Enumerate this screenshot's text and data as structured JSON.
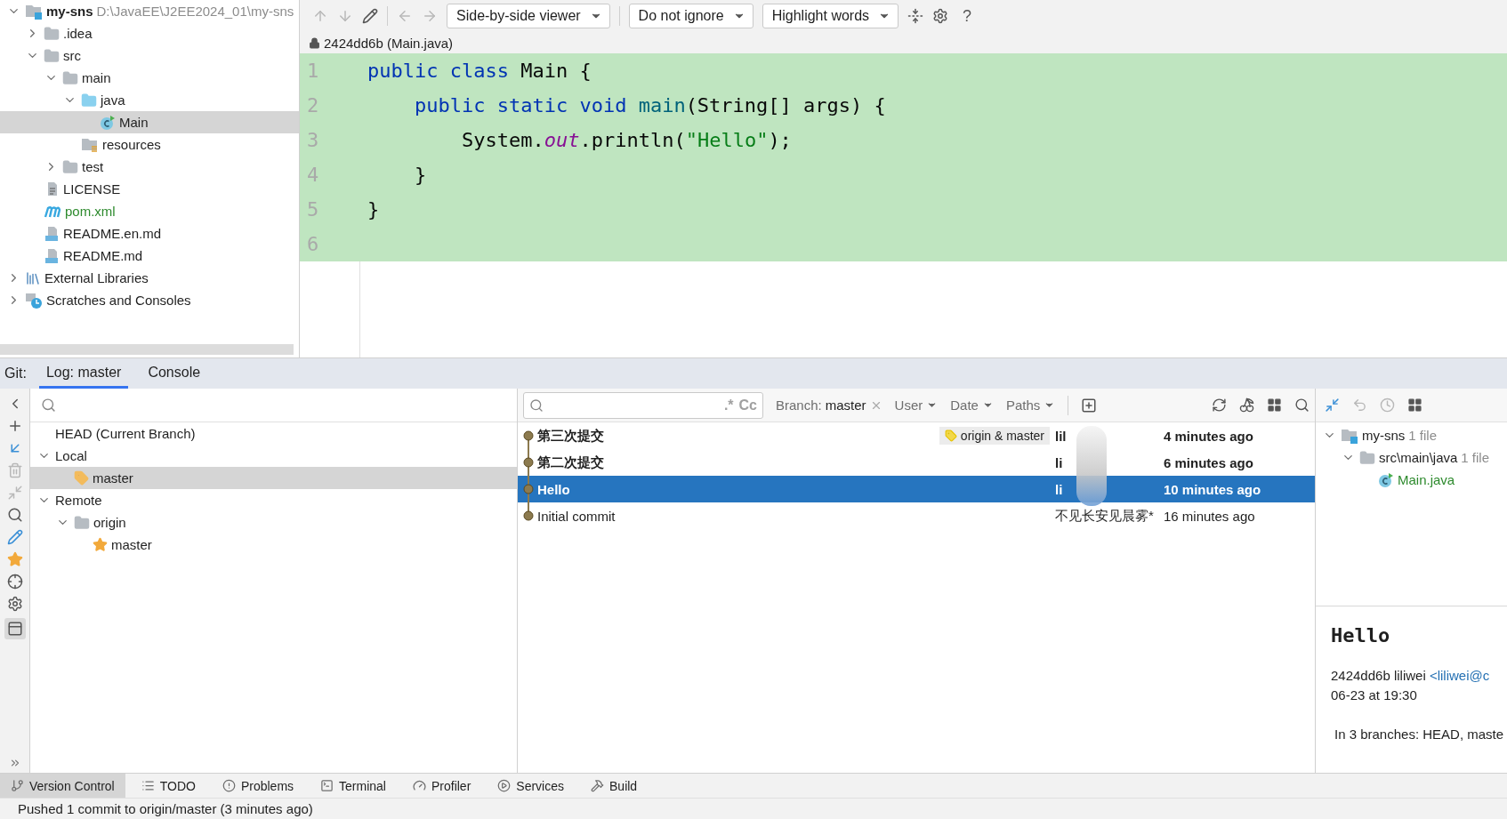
{
  "project": {
    "tree": [
      {
        "label": "my-sns",
        "detail": "D:\\JavaEE\\J2EE2024_01\\my-sns",
        "kind": "module",
        "expanded": true,
        "selected": false,
        "added": false,
        "children": [
          {
            "label": ".idea",
            "kind": "folder",
            "expanded": false,
            "selected": false,
            "added": false
          },
          {
            "label": "src",
            "kind": "folder",
            "expanded": true,
            "selected": false,
            "added": false,
            "children": [
              {
                "label": "main",
                "kind": "folder",
                "expanded": true,
                "selected": false,
                "added": false,
                "children": [
                  {
                    "label": "java",
                    "kind": "source-folder",
                    "expanded": true,
                    "selected": false,
                    "added": false,
                    "children": [
                      {
                        "label": "Main",
                        "kind": "class",
                        "selected": true,
                        "added": false
                      }
                    ]
                  },
                  {
                    "label": "resources",
                    "kind": "resources-folder",
                    "selected": false,
                    "added": false
                  }
                ]
              },
              {
                "label": "test",
                "kind": "folder",
                "expanded": false,
                "selected": false,
                "added": false
              }
            ]
          },
          {
            "label": "LICENSE",
            "kind": "text-file",
            "selected": false,
            "added": false
          },
          {
            "label": "pom.xml",
            "kind": "maven",
            "selected": false,
            "added": true
          },
          {
            "label": "README.en.md",
            "kind": "markdown",
            "selected": false,
            "added": false
          },
          {
            "label": "README.md",
            "kind": "markdown",
            "selected": false,
            "added": false
          }
        ]
      },
      {
        "label": "External Libraries",
        "kind": "libraries",
        "expanded": false,
        "selected": false,
        "added": false
      },
      {
        "label": "Scratches and Consoles",
        "kind": "scratches",
        "expanded": false,
        "selected": false,
        "added": false
      }
    ]
  },
  "editor": {
    "dropdowns": [
      "Side-by-side viewer",
      "Do not ignore",
      "Highlight words"
    ],
    "help": "?",
    "file": "2424dd6b (Main.java)",
    "lines": [
      {
        "number": "1",
        "tokens": [
          {
            "kind": "keyword",
            "text": "public class "
          },
          {
            "kind": "plain",
            "text": "Main {"
          }
        ]
      },
      {
        "number": "2",
        "tokens": [
          {
            "kind": "keyword",
            "text": "    public static void "
          },
          {
            "kind": "method",
            "text": "main"
          },
          {
            "kind": "plain",
            "text": "(String[] args) {"
          }
        ]
      },
      {
        "number": "3",
        "tokens": [
          {
            "kind": "plain",
            "text": "        System."
          },
          {
            "kind": "field",
            "text": "out"
          },
          {
            "kind": "plain",
            "text": ".println("
          },
          {
            "kind": "string",
            "text": "\"Hello\""
          },
          {
            "kind": "plain",
            "text": ");"
          }
        ]
      },
      {
        "number": "4",
        "tokens": [
          {
            "kind": "plain",
            "text": "    }"
          }
        ]
      },
      {
        "number": "5",
        "tokens": [
          {
            "kind": "plain",
            "text": "}"
          }
        ]
      },
      {
        "number": "6"
      }
    ]
  },
  "git": {
    "prefix": "Git:",
    "tabs": [
      {
        "label": "Log: master",
        "selected": true
      },
      {
        "label": "Console",
        "selected": false
      }
    ],
    "branches": [
      {
        "label": "HEAD (Current Branch)",
        "selected": false
      },
      {
        "label": "Local",
        "expanded": true,
        "selected": false,
        "children": [
          {
            "label": "master",
            "kind": "tag",
            "selected": true
          }
        ]
      },
      {
        "label": "Remote",
        "expanded": true,
        "selected": false,
        "children": [
          {
            "label": "origin",
            "kind": "folder",
            "expanded": true,
            "selected": false,
            "children": [
              {
                "label": "master",
                "kind": "star",
                "selected": false
              }
            ]
          }
        ]
      }
    ],
    "filter": {
      "regex": ".*",
      "case": "Cc",
      "branch_label": "Branch:",
      "branch_value": "master",
      "menus": [
        "User",
        "Date",
        "Paths"
      ]
    },
    "commits": [
      {
        "subject": "第三次提交",
        "refs": "origin & master",
        "author": "lil",
        "date": "4 minutes ago",
        "bold": true,
        "selected": false
      },
      {
        "subject": "第二次提交",
        "author": "li",
        "date": "6 minutes ago",
        "bold": true,
        "selected": false
      },
      {
        "subject": "Hello",
        "author": "li",
        "date": "10 minutes ago",
        "bold": true,
        "selected": true
      },
      {
        "subject": "Initial commit",
        "author": "不见长安见晨雾*",
        "date": "16 minutes ago",
        "bold": false,
        "selected": false
      }
    ],
    "changes": [
      {
        "label": "my-sns",
        "count": "1 file",
        "kind": "module",
        "expanded": true,
        "children": [
          {
            "label": "src\\main\\java",
            "count": "1 file",
            "kind": "folder",
            "expanded": true,
            "children": [
              {
                "label": "Main.java",
                "kind": "class"
              }
            ]
          }
        ]
      }
    ],
    "details": {
      "title": "Hello",
      "hash_author": "2424dd6b liliwei",
      "email": "<liliwei@c",
      "date": "06-23 at 19:30",
      "branches": "In 3 branches: HEAD, maste"
    }
  },
  "tool_windows": [
    {
      "label": "Version Control",
      "kind": "branch",
      "selected": true
    },
    {
      "label": "TODO",
      "kind": "list",
      "selected": false
    },
    {
      "label": "Problems",
      "kind": "alert",
      "selected": false
    },
    {
      "label": "Terminal",
      "kind": "terminal",
      "selected": false
    },
    {
      "label": "Profiler",
      "kind": "gauge",
      "selected": false
    },
    {
      "label": "Services",
      "kind": "play",
      "selected": false
    },
    {
      "label": "Build",
      "kind": "hammer",
      "selected": false
    }
  ],
  "status_bar": "Pushed 1 commit to origin/master (3 minutes ago)"
}
